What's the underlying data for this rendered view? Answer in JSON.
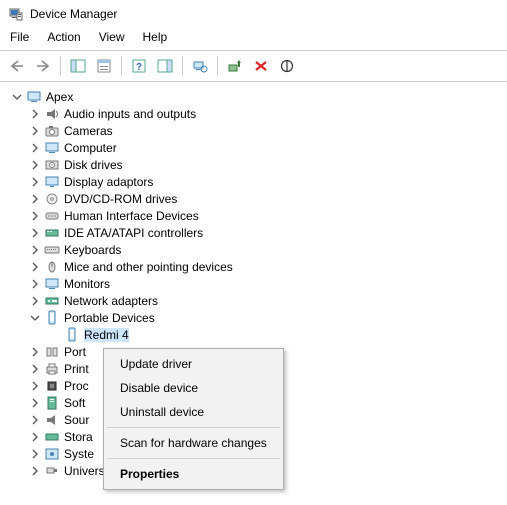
{
  "window": {
    "title": "Device Manager"
  },
  "menu": {
    "file": "File",
    "action": "Action",
    "view": "View",
    "help": "Help"
  },
  "tree": {
    "root": "Apex",
    "items": [
      "Audio inputs and outputs",
      "Cameras",
      "Computer",
      "Disk drives",
      "Display adaptors",
      "DVD/CD-ROM drives",
      "Human Interface Devices",
      "IDE ATA/ATAPI controllers",
      "Keyboards",
      "Mice and other pointing devices",
      "Monitors",
      "Network adapters"
    ],
    "portable": {
      "label": "Portable Devices",
      "child": "Redmi 4"
    },
    "tail": [
      "Port",
      "Print",
      "Proc",
      "Soft",
      "Sour",
      "Stora",
      "Syste"
    ],
    "last": "Universal Serial Bus controllers"
  },
  "context": {
    "update": "Update driver",
    "disable": "Disable device",
    "uninstall": "Uninstall device",
    "scan": "Scan for hardware changes",
    "properties": "Properties"
  }
}
